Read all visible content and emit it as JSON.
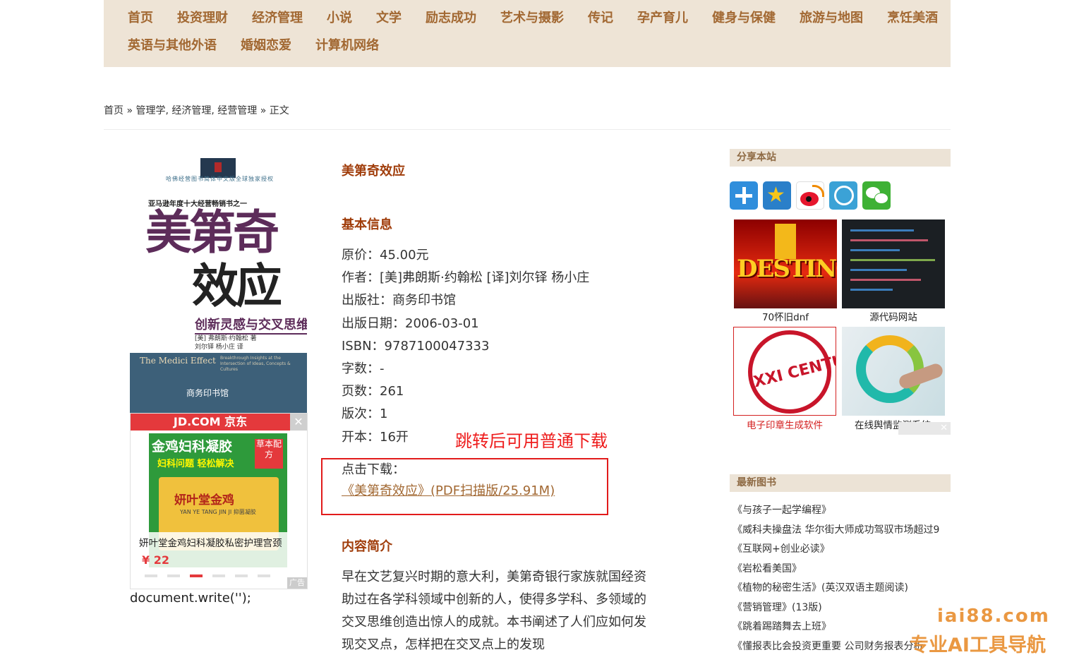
{
  "nav": {
    "row1": [
      "首页",
      "投资理财",
      "经济管理",
      "小说",
      "文学",
      "励志成功",
      "艺术与摄影",
      "传记",
      "孕产育儿",
      "健身与保健",
      "旅游与地图",
      "烹饪美酒"
    ],
    "row2": [
      "英语与其他外语",
      "婚姻恋爱",
      "计算机网络"
    ]
  },
  "breadcrumb": {
    "home": "首页",
    "sep1": " » ",
    "cat1": "管理学",
    "comma1": ", ",
    "cat2": "经济管理",
    "comma2": ", ",
    "cat3": "经营管理",
    "sep2": " » ",
    "current": "正文"
  },
  "cover": {
    "top_line": "哈佛经营图书简体中文版全球独家授权",
    "series": "亚马逊年度十大经营畅销书之一",
    "title_line1": "美第奇",
    "title_line2": "效应",
    "subtitle": "创新灵感与交叉思维",
    "authors_line1": "[美] 弗朗斯·约翰松 著",
    "authors_line2": "刘尔铎 杨小庄 译",
    "en_title": "The Medici Effect",
    "en_subtitle": "Breakthrough Insights at the Intersection of Ideas, Concepts & Cultures",
    "publisher": "商务印书馆"
  },
  "ad": {
    "brand": "JD.COM 京东",
    "close": "✕",
    "product_headline": "金鸡妇科凝胶",
    "product_tagline": "妇科问题 轻松解决",
    "badge": "草本配方",
    "box_title": "妍叶堂金鸡",
    "box_note": "YAN YE TANG JIN JI 抑菌凝胶",
    "product_name": "妍叶堂金鸡妇科凝胶私密护理宫颈",
    "price": "¥ 22",
    "tag": "广告"
  },
  "docwrite": "document.write('');",
  "book": {
    "title": "美第奇效应",
    "basic_heading": "基本信息",
    "info": [
      "原价：45.00元",
      "作者：[美]弗朗斯·约翰松 [译]刘尔铎 杨小庄",
      "出版社：商务印书馆",
      "出版日期：2006-03-01",
      "ISBN：9787100047333",
      "字数：-",
      "页数：261",
      "版次：1",
      "开本：16开"
    ],
    "jump_note": "跳转后可用普通下载",
    "download_label": "点击下载：",
    "download_link": "《美第奇效应》(PDF扫描版/25.91M)",
    "intro_heading": "内容简介",
    "intro_text": "早在文艺复兴时期的意大利，美第奇银行家族就国经资助过在各学科领域中创新的人，使得多学科、多领域的交叉思维创造出惊人的成就。本书阐述了人们应如何发现交叉点，怎样把在交叉点上的发现"
  },
  "sidebar": {
    "share_heading": "分享本站",
    "share_icons": [
      "plus-icon",
      "qzone-icon",
      "weibo-icon",
      "tencent-weibo-icon",
      "wechat-icon"
    ],
    "ads": {
      "dnf_logo": "DESTINO",
      "dnf_caption": "70怀旧dnf",
      "code_caption": "源代码网站",
      "stamp_logo": "XXI CENTURY",
      "stamp_caption": "电子印章生成软件",
      "monitor_caption": "在线舆情监测系统",
      "close": "✕"
    },
    "new_heading": "最新图书",
    "new_books": [
      "《与孩子一起学编程》",
      "《威科夫操盘法 华尔街大师成功驾驭市场超过9",
      "《互联网+创业必读》",
      "《岩松看美国》",
      "《植物的秘密生活》(英汉双语主题阅读)",
      "《营销管理》(13版)",
      "《跳着踢踏舞去上班》",
      "《懂报表比会投资更重要 公司财务报表分析"
    ]
  },
  "watermark": {
    "domain": "iai88.com",
    "slogan": "专业AI工具导航"
  },
  "colors": {
    "nav_bg": "#eee4d6",
    "nav_text": "#a26832",
    "heading": "#a03d0b",
    "alert_red": "#ee1c1c",
    "watermark": "#e88d2e"
  }
}
